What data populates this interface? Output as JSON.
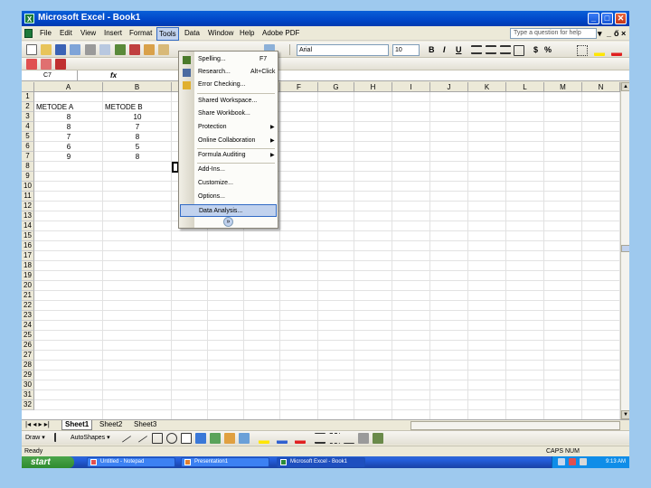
{
  "window": {
    "title": "Microsoft Excel - Book1",
    "minimize": "_",
    "restore": "□",
    "close": "✕"
  },
  "menu": {
    "items": [
      "File",
      "Edit",
      "View",
      "Insert",
      "Format",
      "Tools",
      "Data",
      "Window",
      "Help",
      "Adobe PDF"
    ],
    "active": "Tools",
    "help_placeholder": "Type a question for help",
    "doc_controls": [
      "▾",
      "_",
      "ő",
      "×"
    ]
  },
  "toolbar": {
    "font_name": "Arial",
    "font_size": "10",
    "bold": "B",
    "italic": "I",
    "underline": "U",
    "currency": "$",
    "percent": "%"
  },
  "formula_bar": {
    "name_box": "C7",
    "fx": "fx",
    "content": ""
  },
  "grid": {
    "columns": [
      "A",
      "B",
      "C",
      "D",
      "E",
      "F",
      "G",
      "H",
      "I",
      "J",
      "K",
      "L",
      "M",
      "N"
    ],
    "rows": [
      "1",
      "2",
      "3",
      "4",
      "5",
      "6",
      "7",
      "8",
      "9",
      "10",
      "11",
      "12",
      "13",
      "14",
      "15",
      "16",
      "17",
      "18",
      "19",
      "20",
      "21",
      "22",
      "23",
      "24",
      "25",
      "26",
      "27",
      "28",
      "29",
      "30",
      "31",
      "32"
    ],
    "cells": [
      {
        "a": "METODE A",
        "b": "METODE B"
      },
      {
        "a": "8",
        "b": "10"
      },
      {
        "a": "8",
        "b": "7"
      },
      {
        "a": "7",
        "b": "8"
      },
      {
        "a": "6",
        "b": "5"
      },
      {
        "a": "9",
        "b": "8"
      }
    ]
  },
  "tools_menu": {
    "items": [
      {
        "label": "Spelling...",
        "shortcut": "F7",
        "arrow": ""
      },
      {
        "label": "Research...",
        "shortcut": "Alt+Click",
        "arrow": ""
      },
      {
        "label": "Error Checking...",
        "shortcut": "",
        "arrow": ""
      },
      {
        "label": "Shared Workspace...",
        "shortcut": "",
        "arrow": ""
      },
      {
        "label": "Share Workbook...",
        "shortcut": "",
        "arrow": ""
      },
      {
        "label": "Protection",
        "shortcut": "",
        "arrow": "▶"
      },
      {
        "label": "Online Collaboration",
        "shortcut": "",
        "arrow": "▶"
      },
      {
        "label": "Formula Auditing",
        "shortcut": "",
        "arrow": "▶"
      },
      {
        "label": "Add-Ins...",
        "shortcut": "",
        "arrow": ""
      },
      {
        "label": "Customize...",
        "shortcut": "",
        "arrow": ""
      },
      {
        "label": "Options...",
        "shortcut": "",
        "arrow": ""
      },
      {
        "label": "Data Analysis...",
        "shortcut": "",
        "arrow": ""
      }
    ],
    "highlighted": "Data Analysis...",
    "expand": "»"
  },
  "sheets": {
    "tabs": [
      "Sheet1",
      "Sheet2",
      "Sheet3"
    ],
    "active": "Sheet1",
    "nav": "|◂ ◂ ▸ ▸|"
  },
  "drawing": {
    "draw_label": "Draw ▾",
    "autoshapes_label": "AutoShapes ▾"
  },
  "status": {
    "left": "Ready",
    "right": "CAPS NUM"
  },
  "taskbar": {
    "start": "start",
    "tasks": [
      "Untitled - Notepad",
      "Presentation1",
      "Microsoft Excel - Book1"
    ],
    "active_task": "Microsoft Excel - Book1",
    "clock": "9:13 AM"
  }
}
